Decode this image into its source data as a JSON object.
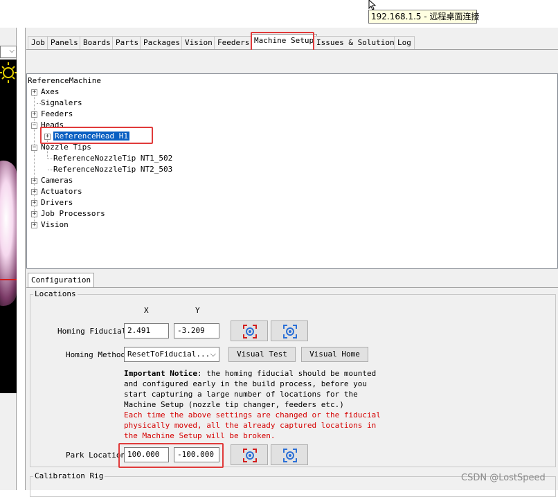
{
  "tooltip": {
    "text": "192.168.1.5 - 远程桌面连接"
  },
  "tabs": [
    "Job",
    "Panels",
    "Boards",
    "Parts",
    "Packages",
    "Vision",
    "Feeders",
    "Machine Setup",
    "Issues & Solutions",
    "Log"
  ],
  "active_tab": "Machine Setup",
  "tree": {
    "root": "ReferenceMachine",
    "axes": "Axes",
    "signalers": "Signalers",
    "feeders": "Feeders",
    "heads": "Heads",
    "head_h1": "ReferenceHead H1",
    "nozzle_tips": "Nozzle Tips",
    "nozzle_tip_1": "ReferenceNozzleTip NT1_502",
    "nozzle_tip_2": "ReferenceNozzleTip NT2_503",
    "cameras": "Cameras",
    "actuators": "Actuators",
    "drivers": "Drivers",
    "job_processors": "Job Processors",
    "vision": "Vision"
  },
  "config_tab": "Configuration",
  "locations": {
    "group_title": "Locations",
    "x_header": "X",
    "y_header": "Y",
    "homing_fiducial_label": "Homing Fiducial",
    "homing_fiducial_x": "2.491",
    "homing_fiducial_y": "-3.209",
    "homing_method_label": "Homing Method",
    "homing_method_value": "ResetToFiducial...",
    "visual_test_label": "Visual Test",
    "visual_home_label": "Visual Home",
    "notice_bold": "Important Notice",
    "notice_text": ": the homing fiducial should be mounted\nand configured early in the build process, before you\nstart capturing a large number of locations for the\nMachine Setup (nozzle tip changer, feeders etc.)",
    "warning_text": "Each time the above settings are changed or the fiducial\nphysically moved, all the already captured locations in\nthe Machine Setup will be broken.",
    "park_location_label": "Park Location",
    "park_x": "100.000",
    "park_y": "-100.000"
  },
  "calibration": {
    "group_title": "Calibration Rig"
  },
  "watermark": "CSDN @LostSpeed",
  "colors": {
    "highlight": "#e03a3a",
    "selection": "#0a5fc2",
    "warning": "#d50000",
    "icon_blue": "#2b6fd6",
    "icon_red": "#d21c1c"
  }
}
